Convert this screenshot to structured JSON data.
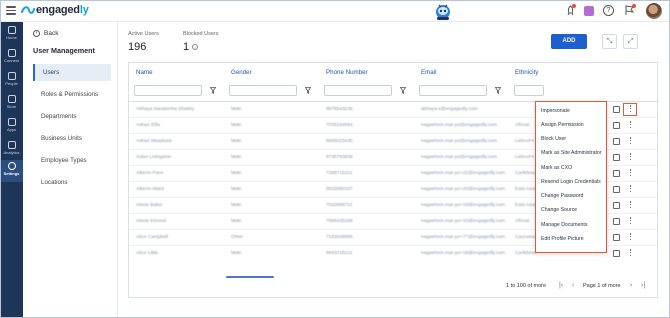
{
  "app": {
    "brand_prefix": "engaged",
    "brand_suffix": "ly"
  },
  "rail": [
    {
      "label": "Home",
      "icon": "home-icon"
    },
    {
      "label": "Connect",
      "icon": "connect-icon"
    },
    {
      "label": "People",
      "icon": "people-icon"
    },
    {
      "label": "Store",
      "icon": "store-icon"
    },
    {
      "label": "Apps",
      "icon": "apps-icon"
    },
    {
      "label": "Analytics",
      "icon": "analytics-icon"
    },
    {
      "label": "Settings",
      "icon": "gear-icon",
      "active": true
    }
  ],
  "sidebar": {
    "back_label": "Back",
    "title": "User Management",
    "items": [
      {
        "label": "Users",
        "active": true
      },
      {
        "label": "Roles & Permissions"
      },
      {
        "label": "Departments"
      },
      {
        "label": "Business Units"
      },
      {
        "label": "Employee Types"
      },
      {
        "label": "Locations"
      }
    ]
  },
  "stats": {
    "active_label": "Active Users",
    "active_value": "196",
    "blocked_label": "Blocked Users",
    "blocked_value": "1",
    "info_glyph": "i"
  },
  "toolbar": {
    "add_label": "ADD",
    "collapse_glyph": "⤡",
    "expand_glyph": "⤢"
  },
  "table": {
    "columns": [
      "Name",
      "Gender",
      "Phone Number",
      "Email",
      "Ethnicity"
    ],
    "rows": [
      [
        "Abhaya Narasimha Shastry",
        "Male",
        "9876543236",
        "abhaya.s@engagedly.com",
        ""
      ],
      [
        "Adrian Ellis",
        "Male",
        "7039184564",
        "nagashree.mar-yo@engagedly.com",
        "African"
      ],
      [
        "Adrian Meadows",
        "Male",
        "8665023430",
        "nagashree.mar-yo@engagedly.com",
        "Latino/Hi"
      ],
      [
        "Aidan Livingston",
        "Male",
        "9735783939",
        "nagashree.mar-yo@engagedly.com",
        "Latino/Hi"
      ],
      [
        "Alberto Pace",
        "Male",
        "7399715221",
        "nagashree.mar-yo+22@engagedly.com",
        "Caribbean"
      ],
      [
        "Alberto Ward",
        "Male",
        "8015580337",
        "nagashree.mar-yo+20@engagedly.com",
        "East Asian"
      ],
      [
        "Alexis Baker",
        "Male",
        "7033998721",
        "nagashree.mar-yo+19@engagedly.com",
        "East Asian"
      ],
      [
        "Alexis Kimmel",
        "Male",
        "7886435189",
        "nagashree.mar-yo+10@engagedly.com",
        "African"
      ],
      [
        "Alice Campbell",
        "Other",
        "7193548995",
        "nagashree.mar-yo+77@engagedly.com",
        "Caucasian"
      ],
      [
        "Alice Little",
        "Male",
        "9693218221",
        "nagashree.mar-yo+18@engagedly.com",
        "Caribbean"
      ]
    ]
  },
  "action_menu": {
    "items": [
      "Impersonate",
      "Assign Permission",
      "Block User",
      "Mark as Site Administrator",
      "Mark as CXO",
      "Resend Login Credentials",
      "Change Password",
      "Change Source",
      "Manage Documents",
      "Edit Profile Picture"
    ]
  },
  "pagination": {
    "range_text": "1 to 100 of more",
    "page_text": "Page 1 of more",
    "first_glyph": "|‹",
    "prev_glyph": "‹",
    "next_glyph": "›",
    "last_glyph": "›|"
  },
  "colors": {
    "accent": "#1e5fcf",
    "rail": "#1d3557",
    "highlight": "#e05a35",
    "column_header": "#1e56b8"
  }
}
